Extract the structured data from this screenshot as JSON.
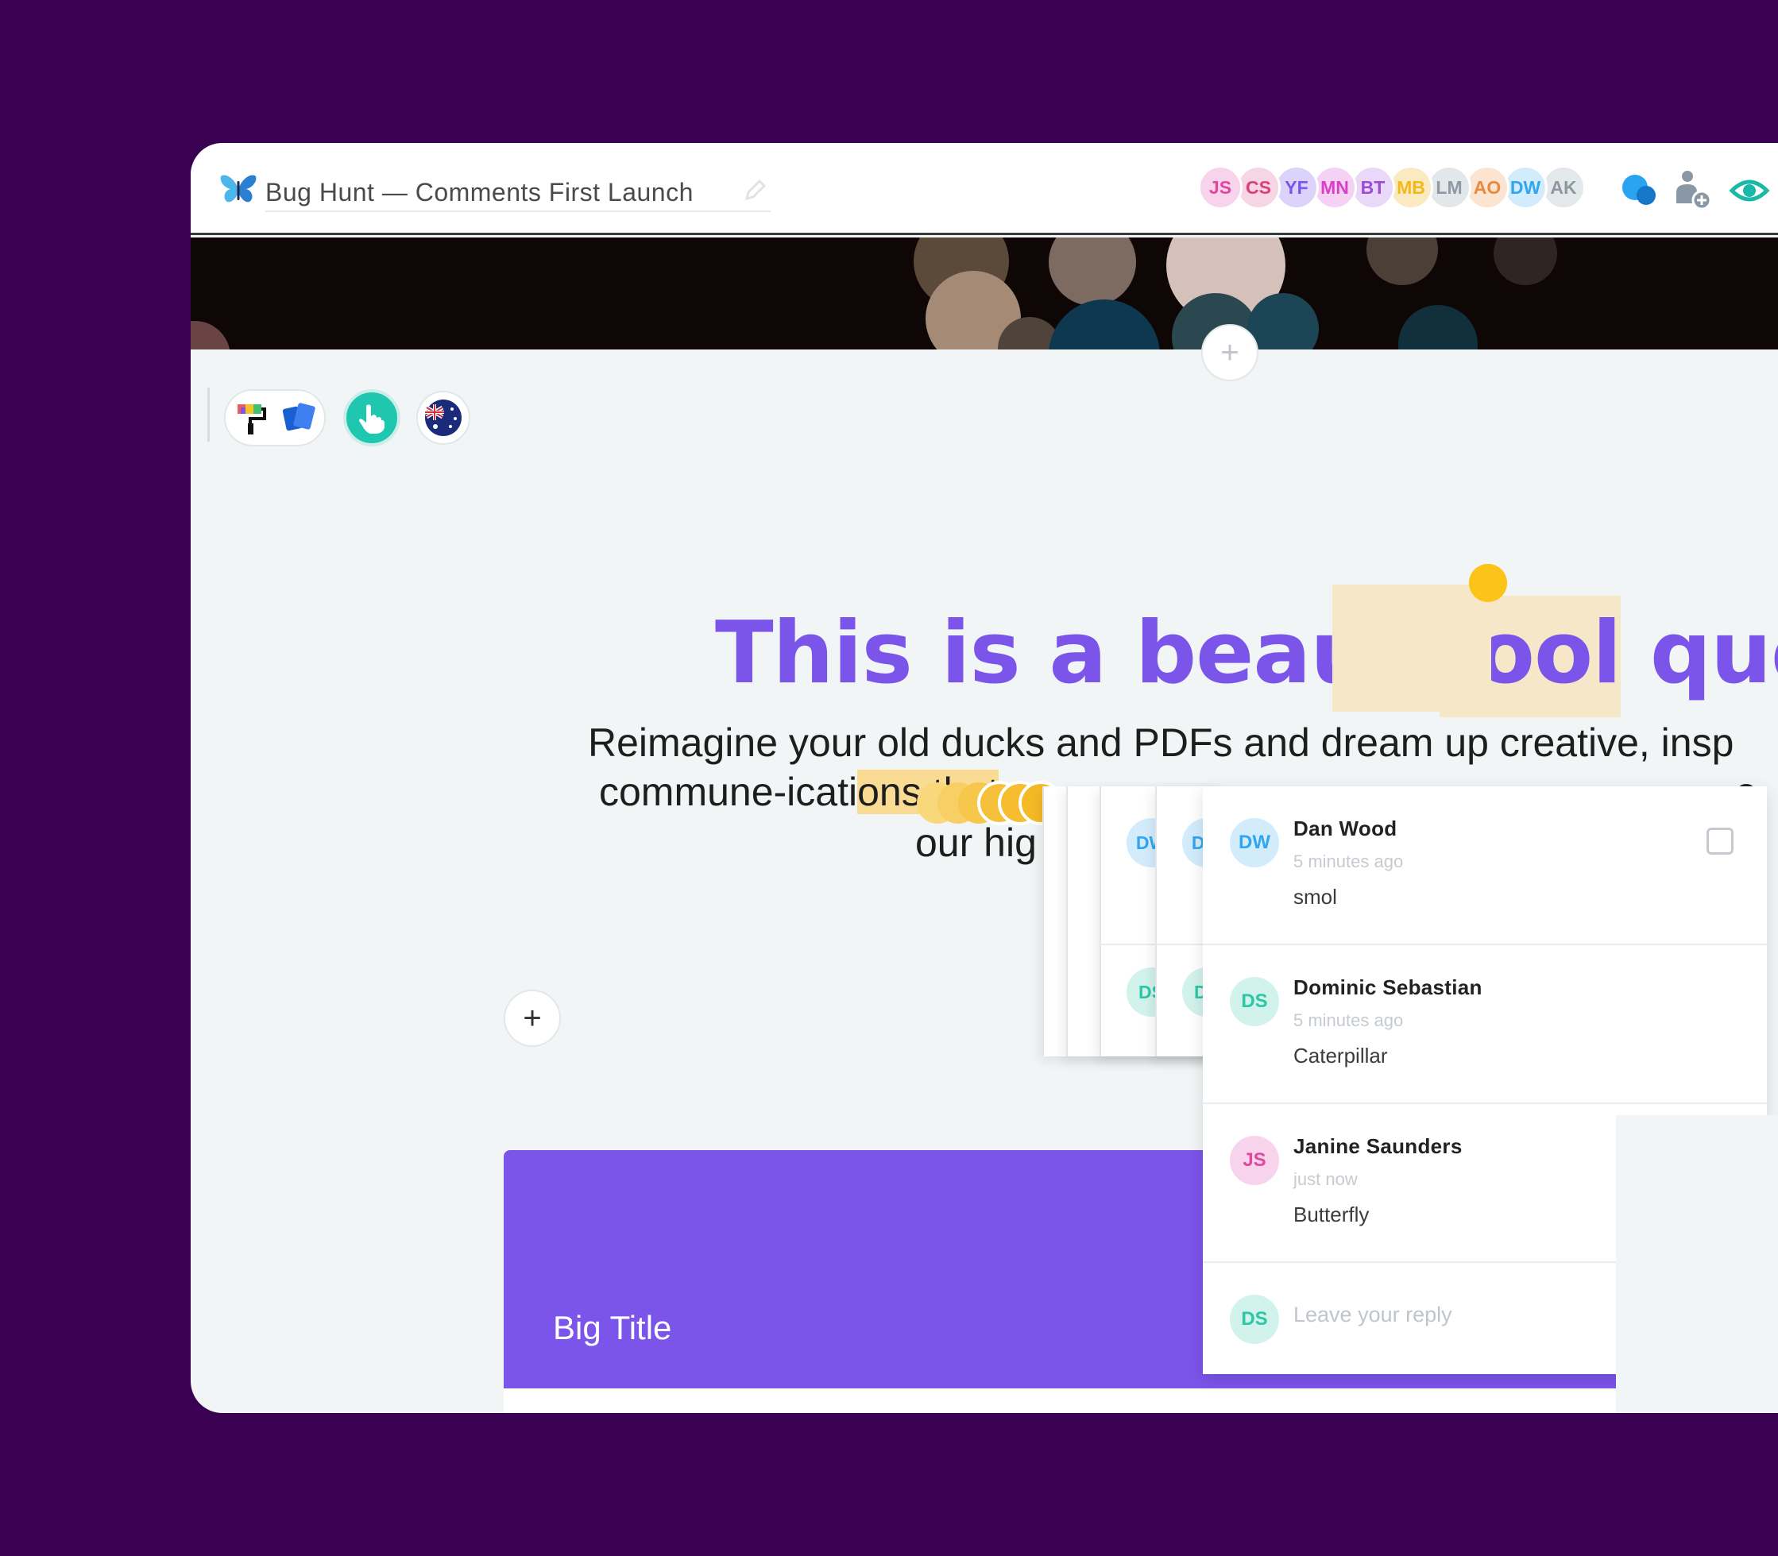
{
  "header": {
    "doc_title": "Bug Hunt — Comments First Launch",
    "logo_icon": "butterfly-icon",
    "edit_icon": "pencil-icon",
    "collaborators": [
      {
        "initials": "JS",
        "bg": "#f7d4ec",
        "fg": "#e0479e"
      },
      {
        "initials": "CS",
        "bg": "#f6d5e4",
        "fg": "#d9407a"
      },
      {
        "initials": "YF",
        "bg": "#dcd3fb",
        "fg": "#7b54ea"
      },
      {
        "initials": "MN",
        "bg": "#f5d2f3",
        "fg": "#d93fc9"
      },
      {
        "initials": "BT",
        "bg": "#e9d8f7",
        "fg": "#9c4bd6"
      },
      {
        "initials": "MB",
        "bg": "#fbeabf",
        "fg": "#f2b81c"
      },
      {
        "initials": "LM",
        "bg": "#e2e7eb",
        "fg": "#8d99a4"
      },
      {
        "initials": "AO",
        "bg": "#fbe5d2",
        "fg": "#e9893e"
      },
      {
        "initials": "DW",
        "bg": "#d3ecfb",
        "fg": "#2fa6ef"
      },
      {
        "initials": "AK",
        "bg": "#e3e8eb",
        "fg": "#8d98a2"
      }
    ],
    "comments_icon": "chat-bubbles-icon",
    "add_user_icon": "add-user-icon",
    "preview_icon": "eye-icon"
  },
  "toolbar": {
    "items": [
      {
        "name": "paint-roller-icon"
      },
      {
        "name": "cards-icon"
      },
      {
        "name": "hand-pointer-icon"
      },
      {
        "name": "australia-flag-icon"
      }
    ]
  },
  "content": {
    "quote_pre": "This is a beauti",
    "quote_hl": "fool",
    "quote_post": " quote",
    "para_line1": "Reimagine your old ducks and PDFs and dream up creative, insp",
    "para_line2_pre": "commune-icati",
    "para_line2_hl": "ons that",
    "para_line2_tail": "e",
    "para_line3": "our hig",
    "add_block": "+",
    "card_title": "Big Title"
  },
  "comments": {
    "stack_initials": [
      "DW",
      "DS"
    ],
    "items": [
      {
        "initials": "DW",
        "name": "Dan Wood",
        "time": "5 minutes ago",
        "text": "smol",
        "bg": "#d3ecfb",
        "fg": "#2fa6ef"
      },
      {
        "initials": "DS",
        "name": "Dominic Sebastian",
        "time": "5 minutes ago",
        "text": "Caterpillar",
        "bg": "#d2f2ec",
        "fg": "#2ec7a6"
      },
      {
        "initials": "JS",
        "name": "Janine Saunders",
        "time": "just now",
        "text": "Butterfly",
        "bg": "#f7d4ec",
        "fg": "#e0479e"
      }
    ],
    "reply_initials": "DS",
    "reply_placeholder": "Leave your reply"
  },
  "colors": {
    "background": "#3a0052",
    "accent": "#7b54ea",
    "highlight": "#f9db93",
    "dot": "#fcc419"
  }
}
